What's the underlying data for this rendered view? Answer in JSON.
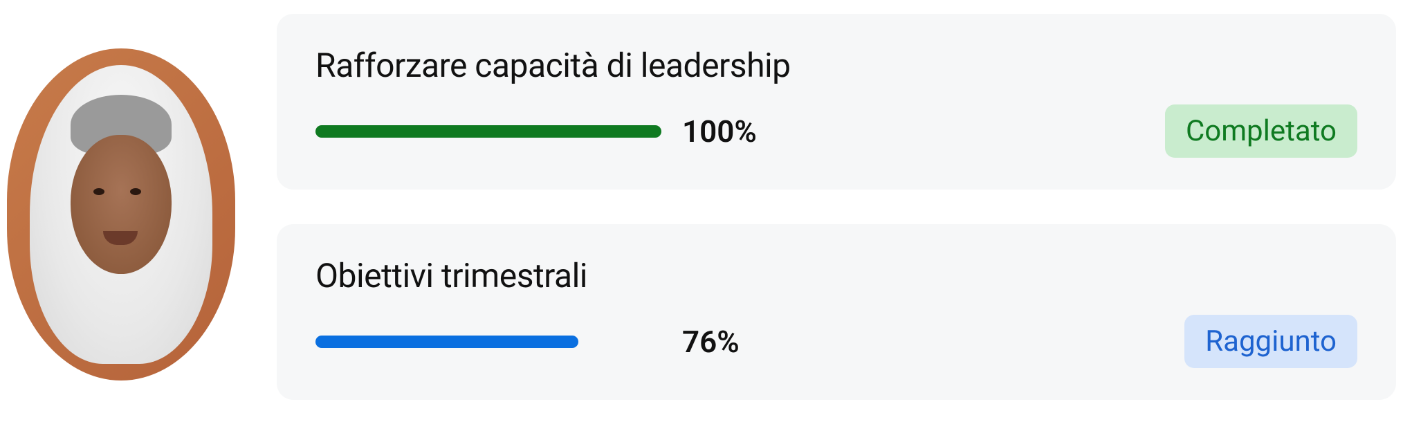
{
  "goals": [
    {
      "title": "Rafforzare capacità di leadership",
      "percent_label": "100%",
      "progress": 100,
      "bar_color": "#0f7a21",
      "status_label": "Completato",
      "status_text_color": "#0f7a21",
      "status_bg_color": "#c9ecce"
    },
    {
      "title": "Obiettivi trimestrali",
      "percent_label": "76%",
      "progress": 76,
      "bar_color": "#0a6fe0",
      "status_label": "Raggiunto",
      "status_text_color": "#1e63d0",
      "status_bg_color": "#d5e4fb"
    }
  ]
}
